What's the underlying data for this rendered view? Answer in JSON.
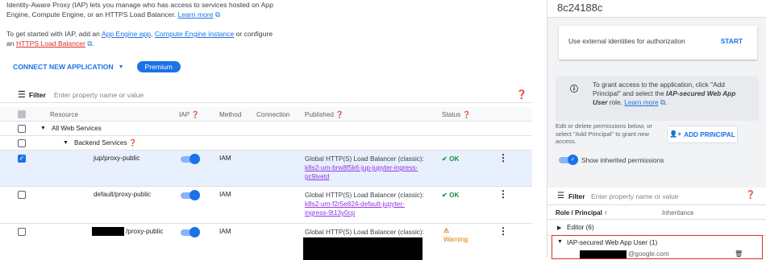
{
  "intro": {
    "line1": "Identity-Aware Proxy (IAP) lets you manage who has access to services hosted on App",
    "line2": "Engine, Compute Engine, or an HTTPS Load Balancer.",
    "learn_more": "Learn more",
    "line3": "To get started with IAP, add an",
    "app_engine_link": "App Engine app",
    "compute_link": "Compute Engine instance",
    "or_configure": "or configure",
    "an": "an",
    "https_lb_link": "HTTPS Load Balancer"
  },
  "toolbar": {
    "connect_label": "CONNECT NEW APPLICATION",
    "premium_label": "Premium"
  },
  "filter": {
    "label": "Filter",
    "placeholder": "Enter property name or value"
  },
  "table": {
    "headers": {
      "resource": "Resource",
      "iap": "IAP",
      "method": "Method",
      "connection": "Connection",
      "published": "Published",
      "status": "Status"
    },
    "group_all": "All Web Services",
    "group_backend": "Backend Services",
    "rows": [
      {
        "resource": "jup/proxy-public",
        "method": "IAM",
        "pub_text": "Global HTTP(S) Load Balancer (classic):",
        "pub_link1": "k8s2-um-brw8f5k6-jup-jupyter-ingress-",
        "pub_link2": "pc9ivetd",
        "status": "OK",
        "checked": true
      },
      {
        "resource": "default/proxy-public",
        "method": "IAM",
        "pub_text": "Global HTTP(S) Load Balancer (classic):",
        "pub_link1": "k8s2-um-f2r5e824-default-jupyter-",
        "pub_link2": "ingress-9t13y0cp",
        "status": "OK",
        "checked": false
      },
      {
        "resource": "/proxy-public",
        "method": "IAM",
        "pub_text": "Global HTTP(S) Load Balancer (classic):",
        "status": "Warning",
        "checked": false
      }
    ]
  },
  "right_panel": {
    "id": "8c24188c",
    "external_label": "Use external identities for authorization",
    "start_label": "START",
    "info_line1": "To grant access to the application, click \"Add",
    "info_line2a": "Principal\" and select the",
    "info_role": "IAP-secured Web App",
    "info_role2": "User",
    "info_line3": "role.",
    "info_learn_more": "Learn more",
    "edit_line1": "Edit or delete permissions below, or",
    "edit_line2": "select \"Add Principal\" to grant new",
    "edit_line3": "access.",
    "add_principal": "ADD PRINCIPAL",
    "show_inherited": "Show inherited permissions",
    "filter_label": "Filter",
    "filter_placeholder": "Enter property name or value",
    "col_role": "Role / Principal",
    "col_inheritance": "Inheritance",
    "editor": "Editor (6)",
    "iap_user": "IAP-secured Web App User (1)",
    "member_suffix": "@google.com"
  }
}
